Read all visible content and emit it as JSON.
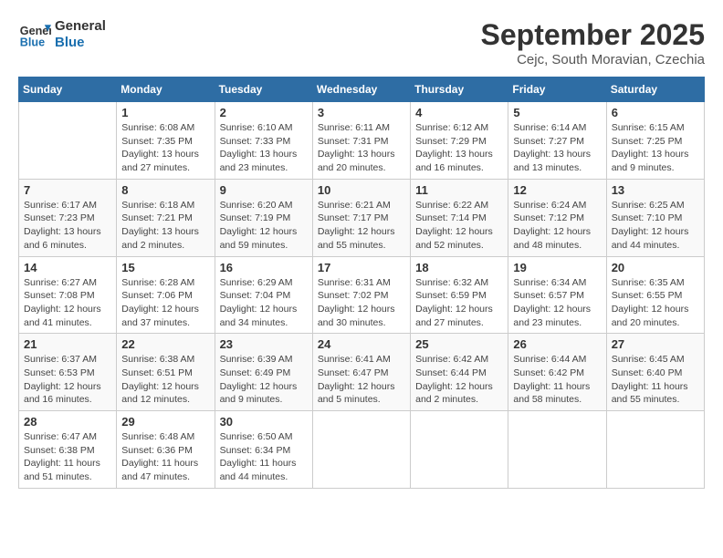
{
  "header": {
    "logo_line1": "General",
    "logo_line2": "Blue",
    "month_title": "September 2025",
    "subtitle": "Cejc, South Moravian, Czechia"
  },
  "weekdays": [
    "Sunday",
    "Monday",
    "Tuesday",
    "Wednesday",
    "Thursday",
    "Friday",
    "Saturday"
  ],
  "weeks": [
    [
      {
        "day": "",
        "sunrise": "",
        "sunset": "",
        "daylight": ""
      },
      {
        "day": "1",
        "sunrise": "Sunrise: 6:08 AM",
        "sunset": "Sunset: 7:35 PM",
        "daylight": "Daylight: 13 hours and 27 minutes."
      },
      {
        "day": "2",
        "sunrise": "Sunrise: 6:10 AM",
        "sunset": "Sunset: 7:33 PM",
        "daylight": "Daylight: 13 hours and 23 minutes."
      },
      {
        "day": "3",
        "sunrise": "Sunrise: 6:11 AM",
        "sunset": "Sunset: 7:31 PM",
        "daylight": "Daylight: 13 hours and 20 minutes."
      },
      {
        "day": "4",
        "sunrise": "Sunrise: 6:12 AM",
        "sunset": "Sunset: 7:29 PM",
        "daylight": "Daylight: 13 hours and 16 minutes."
      },
      {
        "day": "5",
        "sunrise": "Sunrise: 6:14 AM",
        "sunset": "Sunset: 7:27 PM",
        "daylight": "Daylight: 13 hours and 13 minutes."
      },
      {
        "day": "6",
        "sunrise": "Sunrise: 6:15 AM",
        "sunset": "Sunset: 7:25 PM",
        "daylight": "Daylight: 13 hours and 9 minutes."
      }
    ],
    [
      {
        "day": "7",
        "sunrise": "Sunrise: 6:17 AM",
        "sunset": "Sunset: 7:23 PM",
        "daylight": "Daylight: 13 hours and 6 minutes."
      },
      {
        "day": "8",
        "sunrise": "Sunrise: 6:18 AM",
        "sunset": "Sunset: 7:21 PM",
        "daylight": "Daylight: 13 hours and 2 minutes."
      },
      {
        "day": "9",
        "sunrise": "Sunrise: 6:20 AM",
        "sunset": "Sunset: 7:19 PM",
        "daylight": "Daylight: 12 hours and 59 minutes."
      },
      {
        "day": "10",
        "sunrise": "Sunrise: 6:21 AM",
        "sunset": "Sunset: 7:17 PM",
        "daylight": "Daylight: 12 hours and 55 minutes."
      },
      {
        "day": "11",
        "sunrise": "Sunrise: 6:22 AM",
        "sunset": "Sunset: 7:14 PM",
        "daylight": "Daylight: 12 hours and 52 minutes."
      },
      {
        "day": "12",
        "sunrise": "Sunrise: 6:24 AM",
        "sunset": "Sunset: 7:12 PM",
        "daylight": "Daylight: 12 hours and 48 minutes."
      },
      {
        "day": "13",
        "sunrise": "Sunrise: 6:25 AM",
        "sunset": "Sunset: 7:10 PM",
        "daylight": "Daylight: 12 hours and 44 minutes."
      }
    ],
    [
      {
        "day": "14",
        "sunrise": "Sunrise: 6:27 AM",
        "sunset": "Sunset: 7:08 PM",
        "daylight": "Daylight: 12 hours and 41 minutes."
      },
      {
        "day": "15",
        "sunrise": "Sunrise: 6:28 AM",
        "sunset": "Sunset: 7:06 PM",
        "daylight": "Daylight: 12 hours and 37 minutes."
      },
      {
        "day": "16",
        "sunrise": "Sunrise: 6:29 AM",
        "sunset": "Sunset: 7:04 PM",
        "daylight": "Daylight: 12 hours and 34 minutes."
      },
      {
        "day": "17",
        "sunrise": "Sunrise: 6:31 AM",
        "sunset": "Sunset: 7:02 PM",
        "daylight": "Daylight: 12 hours and 30 minutes."
      },
      {
        "day": "18",
        "sunrise": "Sunrise: 6:32 AM",
        "sunset": "Sunset: 6:59 PM",
        "daylight": "Daylight: 12 hours and 27 minutes."
      },
      {
        "day": "19",
        "sunrise": "Sunrise: 6:34 AM",
        "sunset": "Sunset: 6:57 PM",
        "daylight": "Daylight: 12 hours and 23 minutes."
      },
      {
        "day": "20",
        "sunrise": "Sunrise: 6:35 AM",
        "sunset": "Sunset: 6:55 PM",
        "daylight": "Daylight: 12 hours and 20 minutes."
      }
    ],
    [
      {
        "day": "21",
        "sunrise": "Sunrise: 6:37 AM",
        "sunset": "Sunset: 6:53 PM",
        "daylight": "Daylight: 12 hours and 16 minutes."
      },
      {
        "day": "22",
        "sunrise": "Sunrise: 6:38 AM",
        "sunset": "Sunset: 6:51 PM",
        "daylight": "Daylight: 12 hours and 12 minutes."
      },
      {
        "day": "23",
        "sunrise": "Sunrise: 6:39 AM",
        "sunset": "Sunset: 6:49 PM",
        "daylight": "Daylight: 12 hours and 9 minutes."
      },
      {
        "day": "24",
        "sunrise": "Sunrise: 6:41 AM",
        "sunset": "Sunset: 6:47 PM",
        "daylight": "Daylight: 12 hours and 5 minutes."
      },
      {
        "day": "25",
        "sunrise": "Sunrise: 6:42 AM",
        "sunset": "Sunset: 6:44 PM",
        "daylight": "Daylight: 12 hours and 2 minutes."
      },
      {
        "day": "26",
        "sunrise": "Sunrise: 6:44 AM",
        "sunset": "Sunset: 6:42 PM",
        "daylight": "Daylight: 11 hours and 58 minutes."
      },
      {
        "day": "27",
        "sunrise": "Sunrise: 6:45 AM",
        "sunset": "Sunset: 6:40 PM",
        "daylight": "Daylight: 11 hours and 55 minutes."
      }
    ],
    [
      {
        "day": "28",
        "sunrise": "Sunrise: 6:47 AM",
        "sunset": "Sunset: 6:38 PM",
        "daylight": "Daylight: 11 hours and 51 minutes."
      },
      {
        "day": "29",
        "sunrise": "Sunrise: 6:48 AM",
        "sunset": "Sunset: 6:36 PM",
        "daylight": "Daylight: 11 hours and 47 minutes."
      },
      {
        "day": "30",
        "sunrise": "Sunrise: 6:50 AM",
        "sunset": "Sunset: 6:34 PM",
        "daylight": "Daylight: 11 hours and 44 minutes."
      },
      {
        "day": "",
        "sunrise": "",
        "sunset": "",
        "daylight": ""
      },
      {
        "day": "",
        "sunrise": "",
        "sunset": "",
        "daylight": ""
      },
      {
        "day": "",
        "sunrise": "",
        "sunset": "",
        "daylight": ""
      },
      {
        "day": "",
        "sunrise": "",
        "sunset": "",
        "daylight": ""
      }
    ]
  ]
}
